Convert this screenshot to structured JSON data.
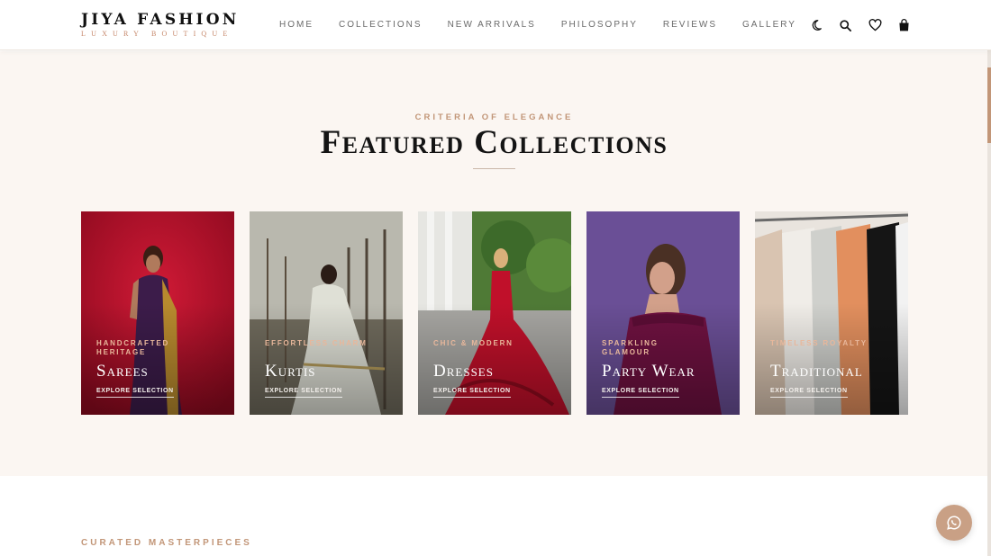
{
  "brand": {
    "name": "JIYA FASHION",
    "tagline": "LUXURY BOUTIQUE"
  },
  "nav": {
    "items": [
      {
        "label": "HOME"
      },
      {
        "label": "COLLECTIONS"
      },
      {
        "label": "NEW ARRIVALS"
      },
      {
        "label": "PHILOSOPHY"
      },
      {
        "label": "REVIEWS"
      },
      {
        "label": "GALLERY"
      }
    ]
  },
  "header_icons": [
    "moon-icon",
    "search-icon",
    "heart-icon",
    "shopping-bag-icon"
  ],
  "featured": {
    "eyebrow": "CRITERIA OF ELEGANCE",
    "title": "Featured Collections",
    "cards": [
      {
        "subtitle": "HANDCRAFTED HERITAGE",
        "title": "Sarees",
        "link": "EXPLORE SELECTION"
      },
      {
        "subtitle": "EFFORTLESS CHARM",
        "title": "Kurtis",
        "link": "EXPLORE SELECTION"
      },
      {
        "subtitle": "CHIC & MODERN",
        "title": "Dresses",
        "link": "EXPLORE SELECTION"
      },
      {
        "subtitle": "SPARKLING GLAMOUR",
        "title": "Party Wear",
        "link": "EXPLORE SELECTION"
      },
      {
        "subtitle": "TIMELESS ROYALTY",
        "title": "Traditional",
        "link": "EXPLORE SELECTION"
      }
    ]
  },
  "lower": {
    "eyebrow": "CURATED MASTERPIECES"
  },
  "floating": {
    "icon": "whatsapp-icon"
  },
  "colors": {
    "accent": "#c29678",
    "section_bg": "#fbf6f2",
    "whatsapp": "#c9a085"
  }
}
